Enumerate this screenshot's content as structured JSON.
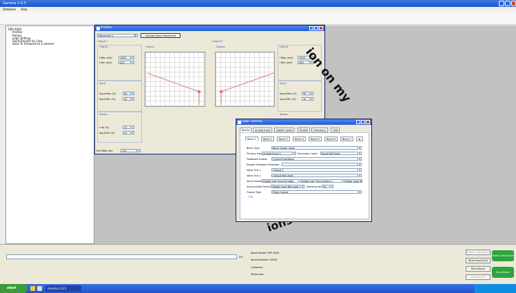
{
  "app": {
    "title": "Gamma 2.0.5",
    "menu": [
      "Database",
      "Help"
    ]
  },
  "tree": {
    "root": "REP-4000",
    "items": [
      "Profiles",
      "Ramps",
      "Logic Setting",
      "Save/Transfer to Cute",
      "Save To Firmware to Customer"
    ]
  },
  "profiles": {
    "title": "Profiles",
    "selector": "Movement 1",
    "change_button": "Change Name Movement",
    "output1": "Output 1",
    "output2": "Output 2",
    "graphs": "Graphs",
    "output": "Output",
    "imax": "I Max (mA)",
    "imin": "I Min (mA)",
    "imax_val": "1000",
    "imin_val": "400",
    "imax2_val": "1000",
    "imin2_val": "400",
    "input": "Input",
    "inmax": "Input Max (%)",
    "inmin": "Input Min (%)",
    "inmax_val": "90",
    "inmin_val": "10",
    "inmax2_val": "90",
    "inmin2_val": "10",
    "ramps": "Ramps",
    "rup": "t Up (%)",
    "rdn": "Input Dn (%)",
    "rup_val": "20",
    "rdn_val": "20",
    "pwm_label": "Pre PWM (Hz)",
    "pwm_val": "100"
  },
  "logic": {
    "title": "Logic Setting",
    "tabs": [
      "Blocks",
      "Analog Input",
      "Digital Inputs",
      "Enable",
      "Frequency",
      "CAN"
    ],
    "block_tabs": [
      "Block 1",
      "Block 2",
      "Block 3",
      "Block 4",
      "Block 5",
      "Block 6",
      "Block 7"
    ],
    "rows": {
      "block_type": {
        "label": "Block Type",
        "value": "Block Single Valve"
      },
      "primary_input": {
        "label": "Primary Input",
        "value": "Analog Input 1",
        "secondary_label": "Secondary Input",
        "secondary_value": "Input Not Used"
      },
      "feedback_enable": {
        "label": "Feedback Enable",
        "value": "Current Feedback"
      },
      "double_feedback": {
        "label": "Double Feedback Selection"
      },
      "valve_out1": {
        "label": "Valve Out 1",
        "value": "Output 1"
      },
      "valve_out2": {
        "label": "Valve Out 2",
        "value": "Output Not Used"
      },
      "input_double": {
        "label": "Input Double",
        "values": [
          "Digital Input",
          "Input Enable",
          "Digital Input",
          "Input Select 1",
          "Digital Input B"
        ]
      },
      "input_enable_deriving": {
        "label": "Input enable Deriving",
        "value": "Digital Input Not used",
        "deriving_label": "Deriving Val",
        "deriving_value": "50"
      },
      "output_type": {
        "label": "Output Type",
        "value": "Proto Output"
      }
    },
    "pts": "PTS"
  },
  "watermark": {
    "arc_text": "ion on my ",
    "bottom_text": "ions - mech"
  },
  "status": {
    "percent": "0%",
    "board_model": "Board Model: REP-4000",
    "serial_number": "Serial Number: 00034",
    "customer": "Customer:",
    "technician": "Technician:",
    "buttons": [
      "Search USB Board",
      "Write Board(OS)",
      "Read Board",
      "Save All Of"
    ],
    "green_buttons": [
      "Reset Shell Board",
      "Send Board"
    ]
  },
  "taskbar": {
    "start": "start",
    "task": "Gamma 2.0.5"
  },
  "colors": {
    "accent": "#1d55c8",
    "green": "#2fa33e"
  }
}
